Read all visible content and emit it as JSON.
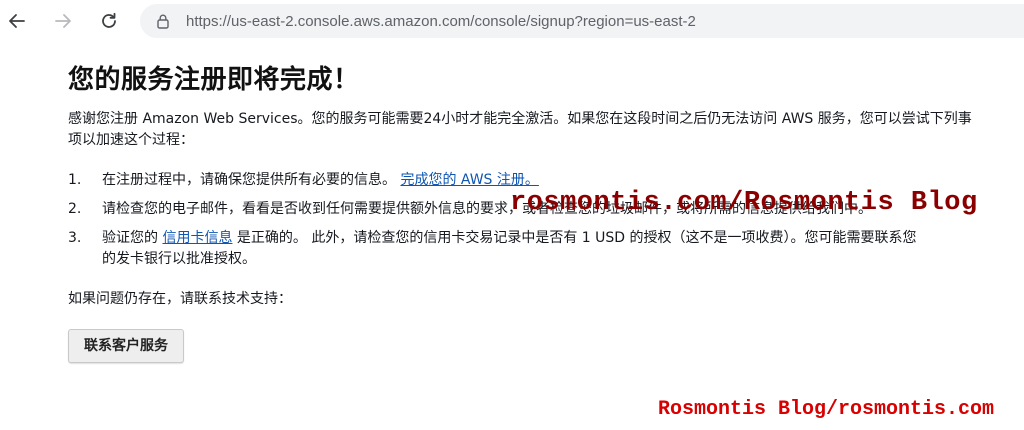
{
  "browser": {
    "url": "https://us-east-2.console.aws.amazon.com/console/signup?region=us-east-2",
    "icons": {
      "back": "arrow-left-icon",
      "forward": "arrow-right-icon",
      "reload": "reload-icon",
      "site_info": "page-info-icon"
    }
  },
  "page": {
    "title": "您的服务注册即将完成！",
    "intro": "感谢您注册 Amazon Web Services。您的服务可能需要24小时才能完全激活。如果您在这段时间之后仍无法访问 AWS 服务，您可以尝试下列事项以加速这个过程：",
    "steps": [
      {
        "num": "1.",
        "text": "在注册过程中，请确保您提供所有必要的信息。",
        "link": "完成您的 AWS 注册。"
      },
      {
        "num": "2.",
        "text": "请检查您的电子邮件，看看是否收到任何需要提供额外信息的要求，或者检查您的垃圾邮件，或将所需的信息提供给我们中。"
      },
      {
        "num": "3.",
        "text_before": "验证您的",
        "link": "信用卡信息",
        "text_after": "是正确的。 此外，请检查您的信用卡交易记录中是否有 1 USD 的授权（这不是一项收费）。您可能需要联系您的发卡银行以批准授权。"
      }
    ],
    "help_text": "如果问题仍存在，请联系技术支持：",
    "contact_button": "联系客户服务"
  },
  "watermarks": {
    "center": "rosmontis.com/Rosmontis Blog",
    "bottom": "Rosmontis Blog/rosmontis.com"
  },
  "colors": {
    "link": "#0f56b3",
    "watermark_center": "#8a0000",
    "watermark_bottom": "#d80000"
  }
}
